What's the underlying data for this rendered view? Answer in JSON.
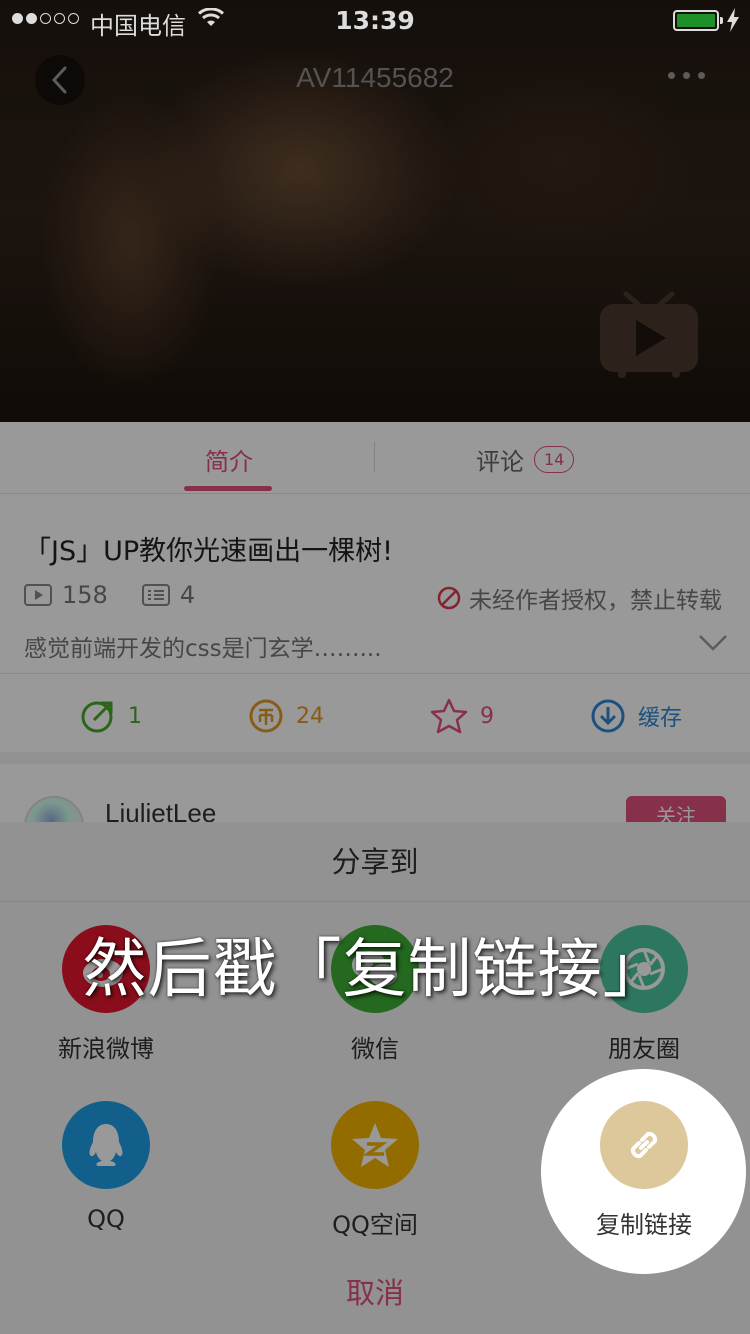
{
  "status_bar": {
    "carrier": "中国电信",
    "time": "13:39"
  },
  "header": {
    "video_id": "AV11455682"
  },
  "tabs": {
    "intro": "简介",
    "comments": "评论",
    "comment_count": "14"
  },
  "video": {
    "title": "「JS」UP教你光速画出一棵树!",
    "plays": "158",
    "danmaku": "4",
    "copyright": "未经作者授权，禁止转载",
    "description": "感觉前端开发的css是门玄学……..."
  },
  "actions": {
    "share_count": "1",
    "coins": "24",
    "favorites": "9",
    "cache_label": "缓存"
  },
  "author": {
    "name": "LiulietLee",
    "follow_label": "关注"
  },
  "share_sheet": {
    "title": "分享到",
    "items": [
      {
        "label": "新浪微博",
        "color": "#e6162d",
        "icon": "weibo-icon"
      },
      {
        "label": "微信",
        "color": "#3cb034",
        "icon": "wechat-icon"
      },
      {
        "label": "朋友圈",
        "color": "#4bc6a0",
        "icon": "moments-icon"
      },
      {
        "label": "QQ",
        "color": "#1e9fe8",
        "icon": "qq-icon"
      },
      {
        "label": "QQ空间",
        "color": "#f5b400",
        "icon": "qzone-icon"
      },
      {
        "label": "复制链接",
        "color": "#dcc89a",
        "icon": "link-icon"
      }
    ],
    "cancel": "取消"
  },
  "caption": "然后戳「复制链接」",
  "colors": {
    "accent": "#e0507b"
  }
}
